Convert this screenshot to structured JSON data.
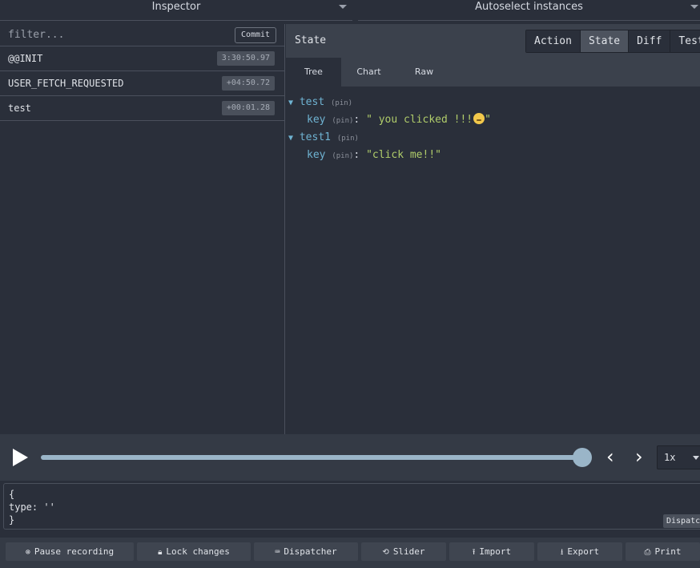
{
  "topbar": {
    "left_select": "Inspector",
    "right_select": "Autoselect instances"
  },
  "left": {
    "filter_placeholder": "filter...",
    "commit_label": "Commit",
    "actions": [
      {
        "name": "@@INIT",
        "time": "3:30:50.97"
      },
      {
        "name": "USER_FETCH_REQUESTED",
        "time": "+04:50.72"
      },
      {
        "name": "test",
        "time": "+00:01.28"
      }
    ]
  },
  "right": {
    "title": "State",
    "tabs": [
      "Action",
      "State",
      "Diff",
      "Test"
    ],
    "active_tab": "State",
    "subtabs": [
      "Tree",
      "Chart",
      "Raw"
    ],
    "active_subtab": "Tree",
    "tree": {
      "node1_key": "test",
      "node1_child_key": "key",
      "node1_child_value": "\" you clicked !!!",
      "node1_child_value_end": "\"",
      "node2_key": "test1",
      "node2_child_key": "key",
      "node2_child_value": "\"click me!!\"",
      "pin_label": "(pin)"
    }
  },
  "slider": {
    "progress": 1.0,
    "speed": "1x"
  },
  "dispatcher": {
    "code": "{\ntype: ''\n}",
    "dispatch_label": "Dispatch"
  },
  "bottom_buttons": [
    {
      "label": "Pause recording",
      "icon": "record-icon"
    },
    {
      "label": "Lock changes",
      "icon": "lock-icon"
    },
    {
      "label": "Dispatcher",
      "icon": "keyboard-icon"
    },
    {
      "label": "Slider",
      "icon": "history-icon"
    },
    {
      "label": "Import",
      "icon": "upload-icon"
    },
    {
      "label": "Export",
      "icon": "download-icon"
    },
    {
      "label": "Print",
      "icon": "print-icon"
    }
  ]
}
